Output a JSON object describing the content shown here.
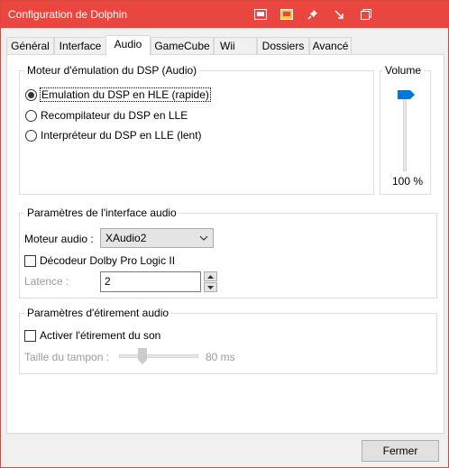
{
  "window": {
    "title": "Configuration de Dolphin",
    "controls": [
      "monitor-icon",
      "window-icon",
      "pin-icon",
      "resize-icon",
      "restore-icon"
    ]
  },
  "tabs": [
    {
      "label": "Général"
    },
    {
      "label": "Interface"
    },
    {
      "label": "Audio"
    },
    {
      "label": "GameCube"
    },
    {
      "label": "Wii"
    },
    {
      "label": "Dossiers"
    },
    {
      "label": "Avancé"
    }
  ],
  "active_tab": "Audio",
  "dsp": {
    "title": "Moteur d'émulation du DSP (Audio)",
    "options": [
      {
        "label": "Emulation du DSP en HLE (rapide)",
        "checked": true
      },
      {
        "label": "Recompilateur du DSP en LLE",
        "checked": false
      },
      {
        "label": "Interpréteur du DSP en LLE (lent)",
        "checked": false
      }
    ]
  },
  "volume": {
    "title": "Volume",
    "value_label": "100 %",
    "level": 1.0
  },
  "interface": {
    "title": "Paramètres de l'interface audio",
    "backend_label": "Moteur audio :",
    "backend_value": "XAudio2",
    "dolby_label": "Décodeur Dolby Pro Logic II",
    "dolby_checked": false,
    "latency_label": "Latence :",
    "latency_value": "2"
  },
  "stretch": {
    "title": "Paramètres d'étirement audio",
    "enable_label": "Activer l'étirement du son",
    "enable_checked": false,
    "buffer_label": "Taille du tampon :",
    "buffer_value": "80 ms",
    "buffer_level": 0.2
  },
  "footer": {
    "close_label": "Fermer"
  },
  "colors": {
    "titlebar": "#e8463f",
    "accent": "#0078d7"
  }
}
